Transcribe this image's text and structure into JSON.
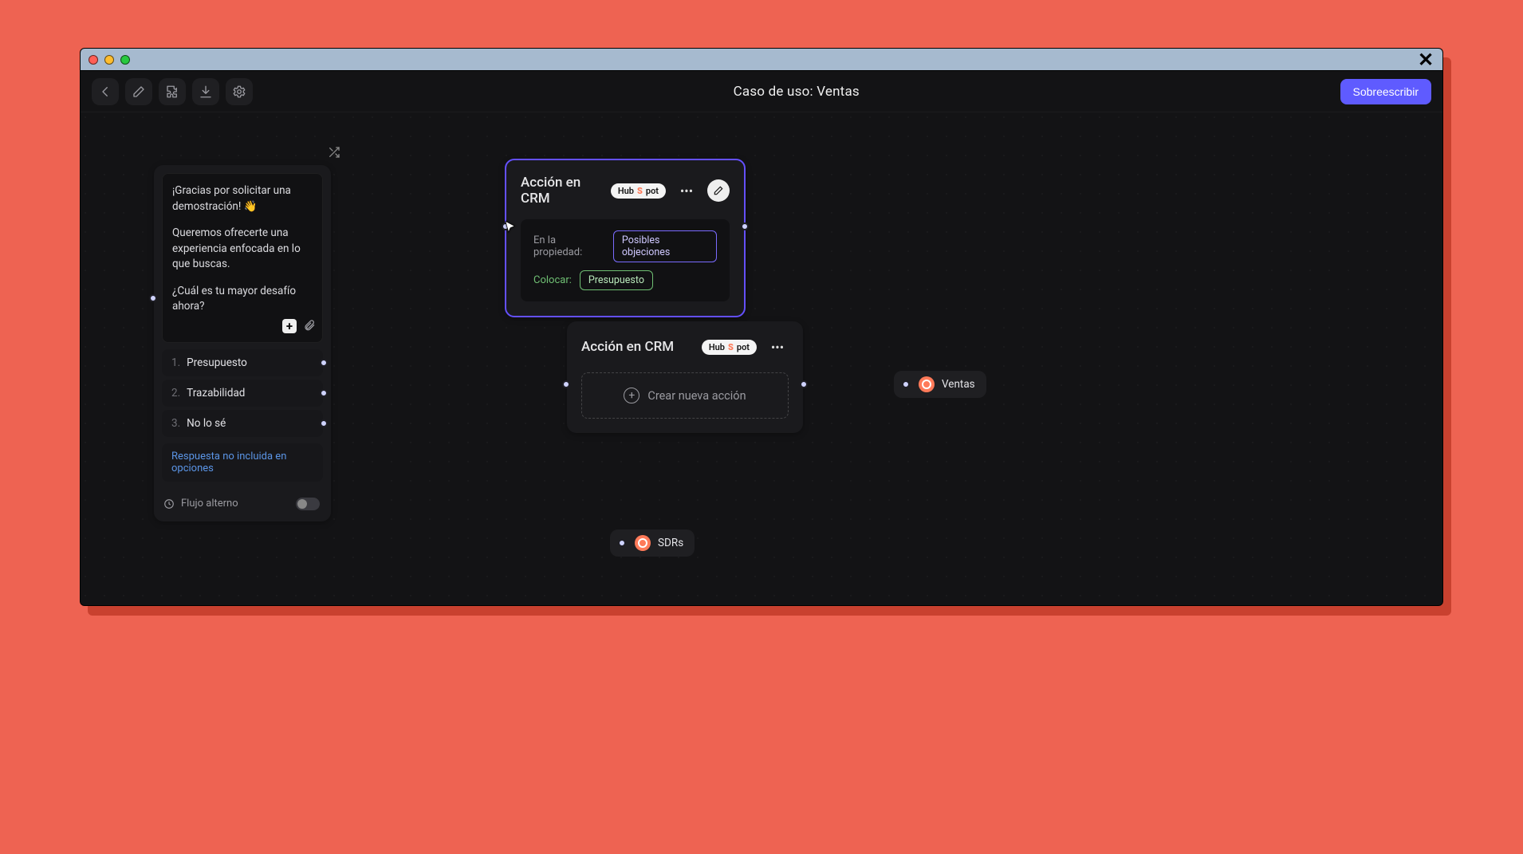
{
  "colors": {
    "coral": "#ee6352",
    "accent": "#6a59ff",
    "hubspot": "#ff7a59",
    "green": "#6fbf73"
  },
  "toolbar": {
    "title": "Caso de uso: Ventas",
    "primary_label": "Sobreescribir"
  },
  "msg_node": {
    "p1": "¡Gracias por solicitar una demostración! 👋",
    "p2": "Queremos ofrecerte una experiencia enfocada en lo que buscas.",
    "p3": "¿Cuál es tu mayor desafío ahora?",
    "options": [
      {
        "n": "1.",
        "label": "Presupuesto"
      },
      {
        "n": "2.",
        "label": "Trazabilidad"
      },
      {
        "n": "3.",
        "label": "No lo sé"
      }
    ],
    "not_included": "Respuesta no incluida en opciones",
    "alt_flow": "Flujo alterno"
  },
  "crm1": {
    "title": "Acción en CRM",
    "badge": "HubSpot",
    "prop_label": "En la propiedad:",
    "prop_val": "Posibles objeciones",
    "colocar_label": "Colocar:",
    "colocar_val": "Presupuesto"
  },
  "crm2": {
    "title": "Acción en CRM",
    "badge": "HubSpot",
    "new_action": "Crear nueva acción"
  },
  "tags": {
    "sdrs": "SDRs",
    "ventas": "Ventas"
  }
}
